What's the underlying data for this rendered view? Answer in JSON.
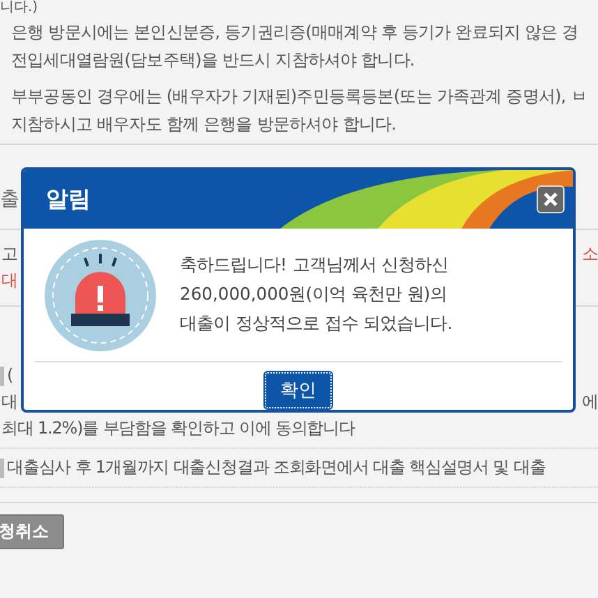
{
  "page": {
    "top_fragment": "니다.)",
    "notices": [
      {
        "lines": [
          "은행 방문시에는 본인신분증, 등기권리증(매매계약 후 등기가 완료되지 않은 경",
          "전입세대열람원(담보주택)을 반드시 지참하셔야 합니다."
        ]
      },
      {
        "lines": [
          "부부공동인 경우에는 (배우자가 기재된)주민등록등본(또는 가족관계 증명서), ㅂ",
          "지참하시고 배우자도 함께 은행을 방문하셔야 합니다."
        ]
      }
    ],
    "section_heading": "출",
    "info_left": "고",
    "info_left_red": "대",
    "info_right_red": "소",
    "agree_items": [
      {
        "left": "(",
        "lines_left": "대",
        "lines_right": "에",
        "tail": "최대 1.2%)를 부담함을 확인하고 이에 동의합니다",
        "checked": false
      },
      {
        "left": "대출심사 후 1개월까지 대출신청결과 조회화면에서 대출 핵심설명서 및 대출",
        "checked": false
      }
    ],
    "cancel_button": "청취소"
  },
  "dialog": {
    "title": "알림",
    "message": [
      "축하드립니다! 고객님께서 신청하신",
      "260,000,000원(이억 육천만 원)의",
      "대출이 정상적으로 접수 되었습니다."
    ],
    "ok_button": "확인"
  }
}
